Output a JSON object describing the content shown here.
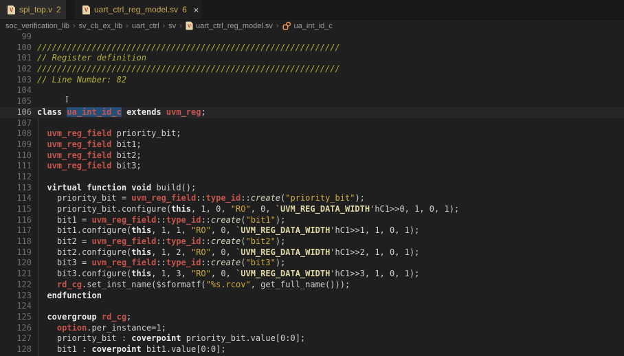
{
  "window": {
    "tabs": [
      {
        "label": "spi_top.v",
        "count": "2",
        "active": false
      },
      {
        "label": "uart_ctrl_reg_model.sv",
        "count": "6",
        "active": true,
        "close_glyph": "×"
      }
    ]
  },
  "icons": {
    "file_letter": "V",
    "file_icon_name": "verilog-file-icon",
    "class_icon_name": "class-symbol-icon",
    "close_icon_name": "close-icon"
  },
  "breadcrumbs": {
    "separator": "›",
    "items": [
      {
        "label": "soc_verification_lib"
      },
      {
        "label": "sv_cb_ex_lib"
      },
      {
        "label": "uart_ctrl"
      },
      {
        "label": "sv"
      },
      {
        "label": "uart_ctrl_reg_model.sv",
        "icon": "verilog-file"
      },
      {
        "label": "ua_int_id_c",
        "icon": "class-symbol"
      }
    ]
  },
  "colors": {
    "bg-editor": "#1f1f1f",
    "bg-tabbar": "#191919",
    "bg-tab-inactive": "#2b2b2b",
    "bg-tab-active": "#1f1f1f",
    "bg-breadcrumb": "#1f1f1f",
    "bg-current-line": "#27272a",
    "bg-selection": "#264f78",
    "tab-text": "#c9ab56",
    "breadcrumb-text": "#9d9d9d",
    "line-number": "#6e6e6e",
    "line-number-active": "#a6a6a6",
    "code-default": "#d0d0d0",
    "keyword": "#e8e8e8",
    "type-red": "#c4544c",
    "string-gold": "#cfae3d",
    "macro": "#ded7a4",
    "method-italic": "#d6d6c2",
    "comment": "#b2b13a",
    "indent-guide": "#3c3c3c",
    "file-icon-bg": "#e6d7ab",
    "file-icon-letter": "#b03030",
    "class-icon": "#e8954f",
    "close-icon": "#cccccc"
  },
  "editor": {
    "selected_word": "ua_int_id_c",
    "current_line": 106,
    "lines": [
      {
        "n": 99,
        "tokens": []
      },
      {
        "n": 100,
        "tokens": [
          [
            "c",
            "/////////////////////////////////////////////////////////////"
          ]
        ]
      },
      {
        "n": 101,
        "tokens": [
          [
            "c",
            "// Register definition"
          ]
        ]
      },
      {
        "n": 102,
        "tokens": [
          [
            "c",
            "/////////////////////////////////////////////////////////////"
          ]
        ]
      },
      {
        "n": 103,
        "tokens": [
          [
            "c",
            "// Line Number: 82"
          ]
        ]
      },
      {
        "n": 104,
        "tokens": []
      },
      {
        "n": 105,
        "tokens": []
      },
      {
        "n": 106,
        "tokens": [
          [
            "k",
            "class"
          ],
          [
            "t",
            " "
          ],
          [
            "w",
            "ua_int_id_c"
          ],
          [
            "t",
            " "
          ],
          [
            "k",
            "extends"
          ],
          [
            "t",
            " "
          ],
          [
            "r",
            "uvm_reg"
          ],
          [
            "t",
            ";"
          ]
        ]
      },
      {
        "n": 107,
        "tokens": []
      },
      {
        "n": 108,
        "tokens": [
          [
            "t",
            "  "
          ],
          [
            "r",
            "uvm_reg_field"
          ],
          [
            "t",
            " priority_bit;"
          ]
        ]
      },
      {
        "n": 109,
        "tokens": [
          [
            "t",
            "  "
          ],
          [
            "r",
            "uvm_reg_field"
          ],
          [
            "t",
            " bit1;"
          ]
        ]
      },
      {
        "n": 110,
        "tokens": [
          [
            "t",
            "  "
          ],
          [
            "r",
            "uvm_reg_field"
          ],
          [
            "t",
            " bit2;"
          ]
        ]
      },
      {
        "n": 111,
        "tokens": [
          [
            "t",
            "  "
          ],
          [
            "r",
            "uvm_reg_field"
          ],
          [
            "t",
            " bit3;"
          ]
        ]
      },
      {
        "n": 112,
        "tokens": []
      },
      {
        "n": 113,
        "tokens": [
          [
            "t",
            "  "
          ],
          [
            "k",
            "virtual"
          ],
          [
            "t",
            " "
          ],
          [
            "k",
            "function"
          ],
          [
            "t",
            " "
          ],
          [
            "k",
            "void"
          ],
          [
            "t",
            " build();"
          ]
        ]
      },
      {
        "n": 114,
        "tokens": [
          [
            "t",
            "    priority_bit = "
          ],
          [
            "r",
            "uvm_reg_field"
          ],
          [
            "t",
            "::"
          ],
          [
            "r",
            "type_id"
          ],
          [
            "t",
            "::"
          ],
          [
            "i",
            "create"
          ],
          [
            "t",
            "("
          ],
          [
            "s",
            "\"priority_bit\""
          ],
          [
            "t",
            ");"
          ]
        ]
      },
      {
        "n": 115,
        "tokens": [
          [
            "t",
            "    priority_bit.configure("
          ],
          [
            "k",
            "this"
          ],
          [
            "t",
            ", 1, 0, "
          ],
          [
            "s",
            "\"RO\""
          ],
          [
            "t",
            ", 0, `"
          ],
          [
            "m",
            "UVM_REG_DATA_WIDTH"
          ],
          [
            "t",
            "'hC1>>0, 1, 0, 1);"
          ]
        ]
      },
      {
        "n": 116,
        "tokens": [
          [
            "t",
            "    bit1 = "
          ],
          [
            "r",
            "uvm_reg_field"
          ],
          [
            "t",
            "::"
          ],
          [
            "r",
            "type_id"
          ],
          [
            "t",
            "::"
          ],
          [
            "i",
            "create"
          ],
          [
            "t",
            "("
          ],
          [
            "s",
            "\"bit1\""
          ],
          [
            "t",
            ");"
          ]
        ]
      },
      {
        "n": 117,
        "tokens": [
          [
            "t",
            "    bit1.configure("
          ],
          [
            "k",
            "this"
          ],
          [
            "t",
            ", 1, 1, "
          ],
          [
            "s",
            "\"RO\""
          ],
          [
            "t",
            ", 0, `"
          ],
          [
            "m",
            "UVM_REG_DATA_WIDTH"
          ],
          [
            "t",
            "'hC1>>1, 1, 0, 1);"
          ]
        ]
      },
      {
        "n": 118,
        "tokens": [
          [
            "t",
            "    bit2 = "
          ],
          [
            "r",
            "uvm_reg_field"
          ],
          [
            "t",
            "::"
          ],
          [
            "r",
            "type_id"
          ],
          [
            "t",
            "::"
          ],
          [
            "i",
            "create"
          ],
          [
            "t",
            "("
          ],
          [
            "s",
            "\"bit2\""
          ],
          [
            "t",
            ");"
          ]
        ]
      },
      {
        "n": 119,
        "tokens": [
          [
            "t",
            "    bit2.configure("
          ],
          [
            "k",
            "this"
          ],
          [
            "t",
            ", 1, 2, "
          ],
          [
            "s",
            "\"RO\""
          ],
          [
            "t",
            ", 0, `"
          ],
          [
            "m",
            "UVM_REG_DATA_WIDTH"
          ],
          [
            "t",
            "'hC1>>2, 1, 0, 1);"
          ]
        ]
      },
      {
        "n": 120,
        "tokens": [
          [
            "t",
            "    bit3 = "
          ],
          [
            "r",
            "uvm_reg_field"
          ],
          [
            "t",
            "::"
          ],
          [
            "r",
            "type_id"
          ],
          [
            "t",
            "::"
          ],
          [
            "i",
            "create"
          ],
          [
            "t",
            "("
          ],
          [
            "s",
            "\"bit3\""
          ],
          [
            "t",
            ");"
          ]
        ]
      },
      {
        "n": 121,
        "tokens": [
          [
            "t",
            "    bit3.configure("
          ],
          [
            "k",
            "this"
          ],
          [
            "t",
            ", 1, 3, "
          ],
          [
            "s",
            "\"RO\""
          ],
          [
            "t",
            ", 0, `"
          ],
          [
            "m",
            "UVM_REG_DATA_WIDTH"
          ],
          [
            "t",
            "'hC1>>3, 1, 0, 1);"
          ]
        ]
      },
      {
        "n": 122,
        "tokens": [
          [
            "t",
            "    "
          ],
          [
            "r",
            "rd_cg"
          ],
          [
            "t",
            ".set_inst_name($sformatf("
          ],
          [
            "s",
            "\"%s.rcov\""
          ],
          [
            "t",
            ", get_full_name()));"
          ]
        ]
      },
      {
        "n": 123,
        "tokens": [
          [
            "t",
            "  "
          ],
          [
            "k",
            "endfunction"
          ]
        ]
      },
      {
        "n": 124,
        "tokens": []
      },
      {
        "n": 125,
        "tokens": [
          [
            "t",
            "  "
          ],
          [
            "k",
            "covergroup"
          ],
          [
            "t",
            " "
          ],
          [
            "r",
            "rd_cg"
          ],
          [
            "t",
            ";"
          ]
        ]
      },
      {
        "n": 126,
        "tokens": [
          [
            "t",
            "    "
          ],
          [
            "r",
            "option"
          ],
          [
            "t",
            ".per_instance=1;"
          ]
        ]
      },
      {
        "n": 127,
        "tokens": [
          [
            "t",
            "    priority_bit : "
          ],
          [
            "k",
            "coverpoint"
          ],
          [
            "t",
            " priority_bit.value[0:0];"
          ]
        ]
      },
      {
        "n": 128,
        "tokens": [
          [
            "t",
            "    bit1 : "
          ],
          [
            "k",
            "coverpoint"
          ],
          [
            "t",
            " bit1.value[0:0];"
          ]
        ]
      }
    ]
  }
}
